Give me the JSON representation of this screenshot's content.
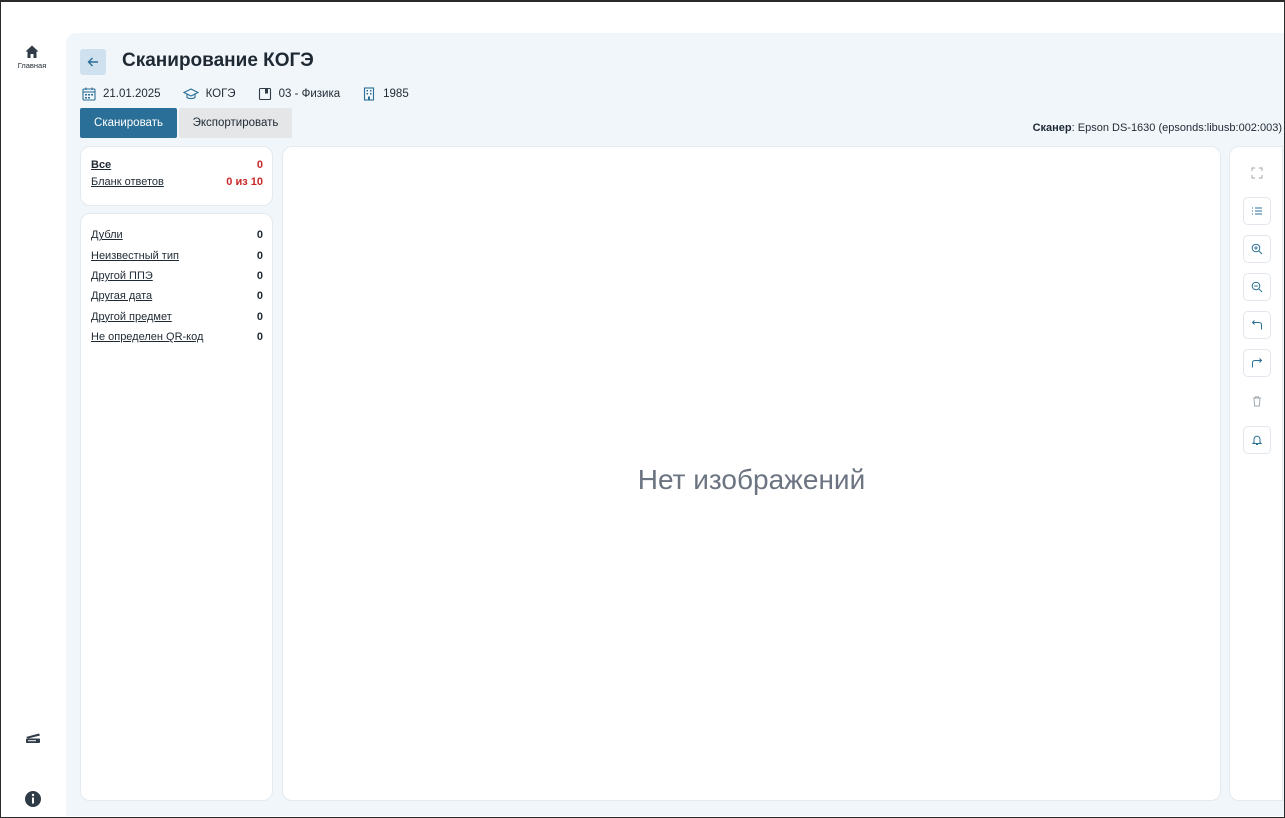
{
  "nav": {
    "home_label": "Главная"
  },
  "header": {
    "title": "Сканирование КОГЭ",
    "date": "21.01.2025",
    "exam": "КОГЭ",
    "subject": "03 - Физика",
    "code": "1985"
  },
  "actions": {
    "scan_label": "Сканировать",
    "export_label": "Экспортировать"
  },
  "scanner": {
    "label": "Сканер",
    "value": ": Epson DS-1630 (epsonds:libusb:002:003)"
  },
  "summary": {
    "items": [
      {
        "label": "Все",
        "count": "0"
      },
      {
        "label": "Бланк ответов",
        "count": "0 из 10"
      }
    ]
  },
  "errors": {
    "items": [
      {
        "label": "Дубли",
        "count": "0"
      },
      {
        "label": "Неизвестный тип",
        "count": "0"
      },
      {
        "label": "Другой ППЭ",
        "count": "0"
      },
      {
        "label": "Другая дата",
        "count": "0"
      },
      {
        "label": "Другой предмет",
        "count": "0"
      },
      {
        "label": "Не определен QR-код",
        "count": "0"
      }
    ]
  },
  "viewer": {
    "empty_text": "Нет изображений"
  },
  "toolbar": {
    "icons": [
      "expand-icon",
      "list-icon",
      "zoom-in-icon",
      "zoom-out-icon",
      "rotate-left-icon",
      "rotate-right-icon",
      "trash-icon",
      "bell-icon"
    ]
  },
  "colors": {
    "accent": "#2a6f97",
    "count_red": "#c62828",
    "background": "#f1f6fa"
  }
}
